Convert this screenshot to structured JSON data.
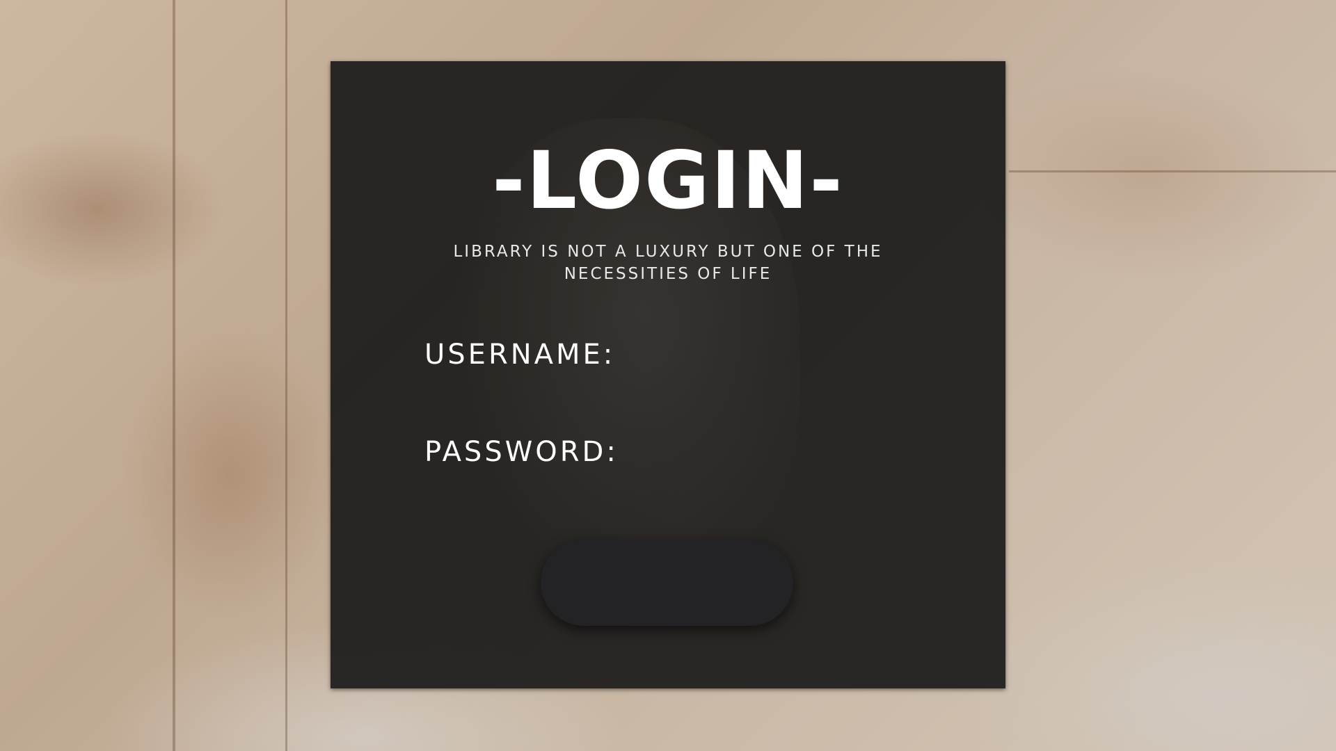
{
  "login": {
    "title": "-LOGIN-",
    "subtitle": "LIBRARY IS NOT A LUXURY BUT ONE OF THE NECESSITIES OF LIFE",
    "username_label": "USERNAME:",
    "username_value": "",
    "password_label": "PASSWORD:",
    "password_value": "",
    "submit_label": ""
  },
  "colors": {
    "panel_background": "#121212",
    "button_background": "#232325",
    "text": "#ffffff"
  }
}
